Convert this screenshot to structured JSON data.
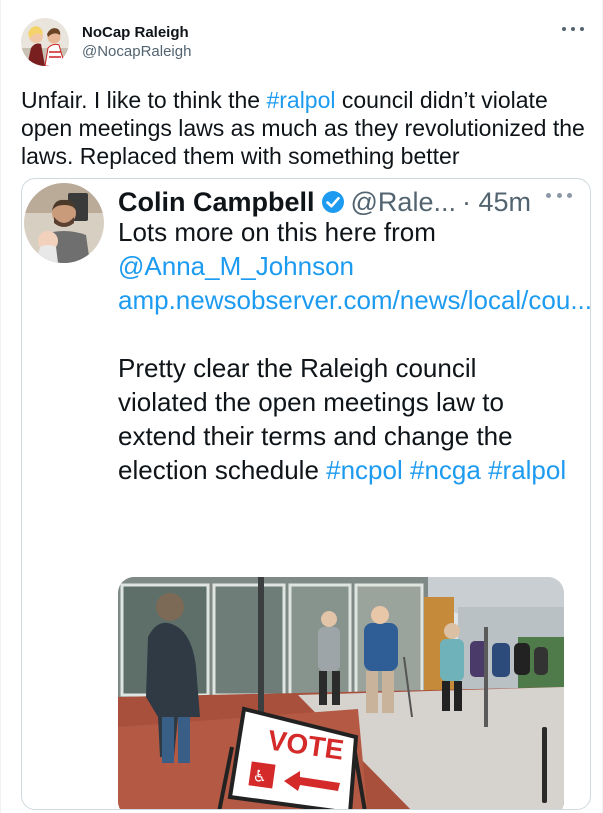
{
  "author": {
    "name": "NoCap Raleigh",
    "handle": "@NocapRaleigh"
  },
  "tweet": {
    "text_1": "Unfair. I like to think the ",
    "hashtag": "#ralpol",
    "text_2": " council didn’t violate open meetings laws as much as they revolutionized the laws. Replaced them with something better"
  },
  "quoted": {
    "name": "Colin Campbell",
    "handle": "@Rale...",
    "time": "· 45m",
    "line_1": "Lots more on this here from",
    "mention": "@Anna_M_Johnson",
    "url": "amp.newsobserver.com/news/local/cou...",
    "text_2": "Pretty clear the Raleigh council violated the open meetings law to extend their terms and change the election schedule ",
    "hashtags": [
      "#ncpol",
      "#ncga",
      "#ralpol"
    ],
    "sign_text": "VOTE"
  },
  "icons": {
    "more": "more-horizontal-icon",
    "verified": "verified-badge-icon",
    "wheelchair": "wheelchair-icon",
    "arrow": "arrow-left-icon"
  },
  "colors": {
    "link": "#1d9bf0",
    "text": "#0f1419",
    "muted": "#536471",
    "sign_red": "#d42a2a"
  }
}
